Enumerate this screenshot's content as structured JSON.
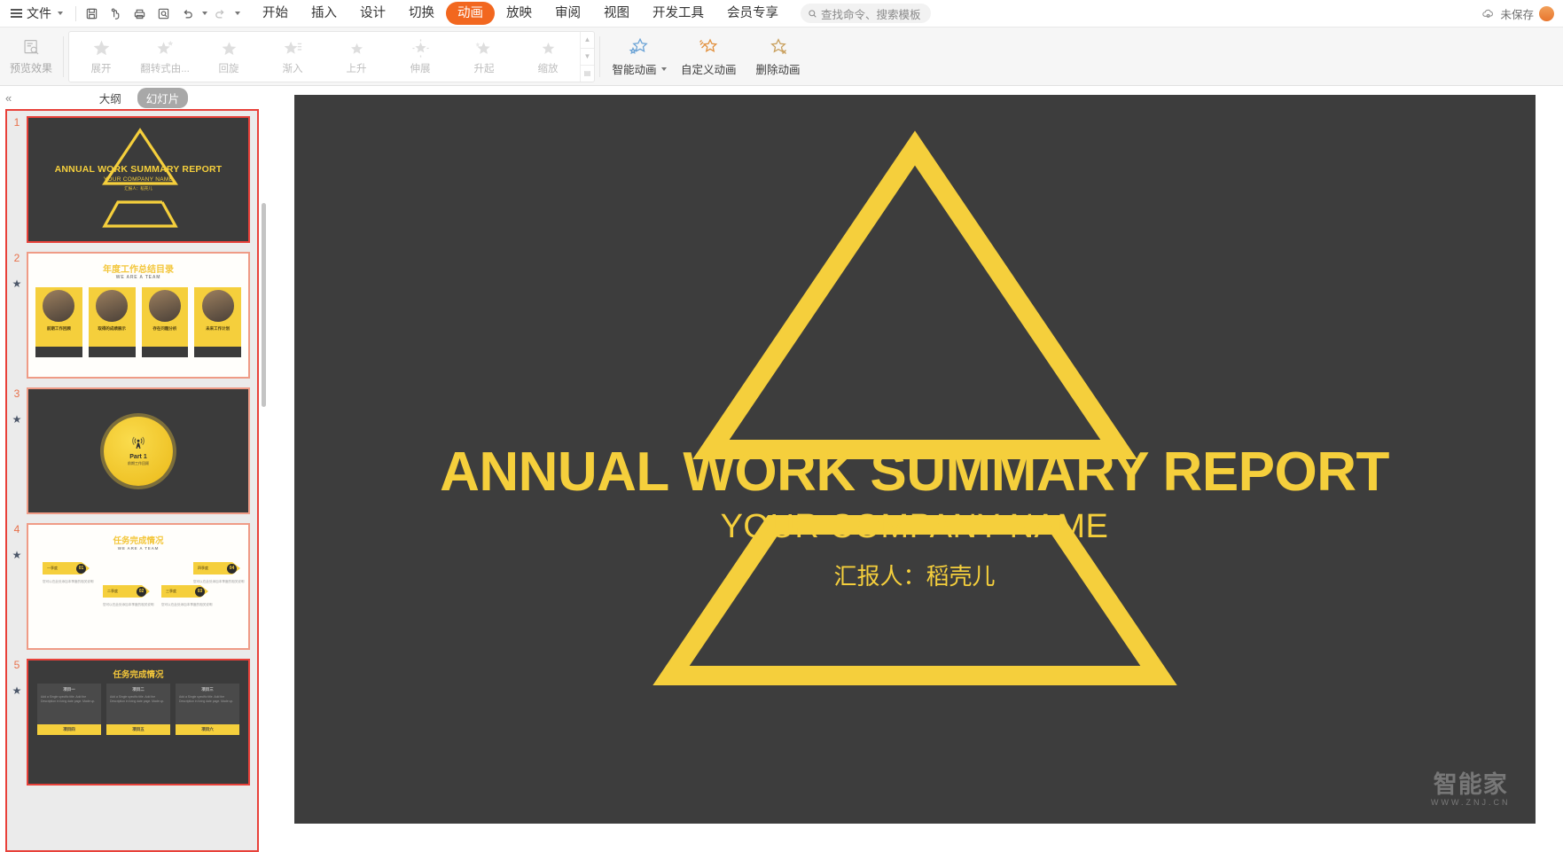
{
  "menubar": {
    "file_label": "文件",
    "quick_icons": [
      "save-icon",
      "touch-icon",
      "print-icon",
      "print-preview-icon",
      "undo-icon",
      "redo-icon",
      "customize-icon"
    ],
    "tabs": [
      {
        "label": "开始",
        "active": false
      },
      {
        "label": "插入",
        "active": false
      },
      {
        "label": "设计",
        "active": false
      },
      {
        "label": "切换",
        "active": false
      },
      {
        "label": "动画",
        "active": true
      },
      {
        "label": "放映",
        "active": false
      },
      {
        "label": "审阅",
        "active": false
      },
      {
        "label": "视图",
        "active": false
      },
      {
        "label": "开发工具",
        "active": false
      },
      {
        "label": "会员专享",
        "active": false
      }
    ],
    "search_placeholder": "查找命令、搜索模板",
    "save_status": "未保存"
  },
  "ribbon": {
    "preview_label": "预览效果",
    "animations": [
      {
        "label": "展开"
      },
      {
        "label": "翻转式由..."
      },
      {
        "label": "回旋"
      },
      {
        "label": "渐入"
      },
      {
        "label": "上升"
      },
      {
        "label": "伸展"
      },
      {
        "label": "升起"
      },
      {
        "label": "缩放"
      }
    ],
    "smart_anim_label": "智能动画",
    "custom_anim_label": "自定义动画",
    "delete_anim_label": "删除动画"
  },
  "sidebar": {
    "collapse_label": "«",
    "tabs": [
      {
        "label": "大纲",
        "active": false
      },
      {
        "label": "幻灯片",
        "active": true
      }
    ],
    "slides": [
      {
        "number": "1",
        "selected": true,
        "has_animation": false,
        "theme": "dark",
        "title": "ANNUAL WORK SUMMARY REPORT",
        "subtitle": "YOUR COMPANY NAME",
        "presenter": "汇报人：稻壳儿"
      },
      {
        "number": "2",
        "selected": false,
        "has_animation": true,
        "theme": "light",
        "title": "年度工作总结目录",
        "subtitle": "WE ARE A TEAM",
        "cards": [
          {
            "caption": "前期工作回顾"
          },
          {
            "caption": "取得的成绩展示"
          },
          {
            "caption": "存在问题分析"
          },
          {
            "caption": "未来工作计划"
          }
        ]
      },
      {
        "number": "3",
        "selected": false,
        "has_animation": true,
        "theme": "dark",
        "part_label": "Part 1",
        "part_cn": "前期工作回顾"
      },
      {
        "number": "4",
        "selected": false,
        "has_animation": true,
        "theme": "light",
        "title": "任务完成情况",
        "subtitle": "WE ARE A TEAM",
        "steps": [
          {
            "num": "01",
            "label": "一季度",
            "desc": "您可以在此处添加本季度的相关说明"
          },
          {
            "num": "02",
            "label": "二季度",
            "desc": "您可以在此处添加本季度的相关说明"
          },
          {
            "num": "03",
            "label": "三季度",
            "desc": "您可以在此处添加本季度的相关说明"
          },
          {
            "num": "04",
            "label": "四季度",
            "desc": "您可以在此处添加本季度的相关说明"
          }
        ]
      },
      {
        "number": "5",
        "selected": true,
        "has_animation": true,
        "theme": "dark",
        "title": "任务完成情况",
        "cells": [
          {
            "heading": "项目一",
            "text": "Add a Single specific title. Add the Description in living date page. Made up.",
            "tag": "项目四"
          },
          {
            "heading": "项目二",
            "text": "Add a Single specific title. Add the Description in living date page. Made up.",
            "tag": "项目五"
          },
          {
            "heading": "项目三",
            "text": "Add a Single specific title. Add the Description in living date page. Made up.",
            "tag": "项目六"
          }
        ]
      }
    ]
  },
  "slide_canvas": {
    "title": "ANNUAL WORK SUMMARY REPORT",
    "subtitle": "YOUR COMPANY NAME",
    "presenter": "汇报人：稻壳儿",
    "watermark_main": "智能家",
    "watermark_sub": "WWW.ZNJ.CN"
  },
  "colors": {
    "accent_yellow": "#f5cf3c",
    "slide_bg": "#3d3d3d",
    "active_tab": "#f2671f",
    "selection_red": "#e8413a"
  }
}
